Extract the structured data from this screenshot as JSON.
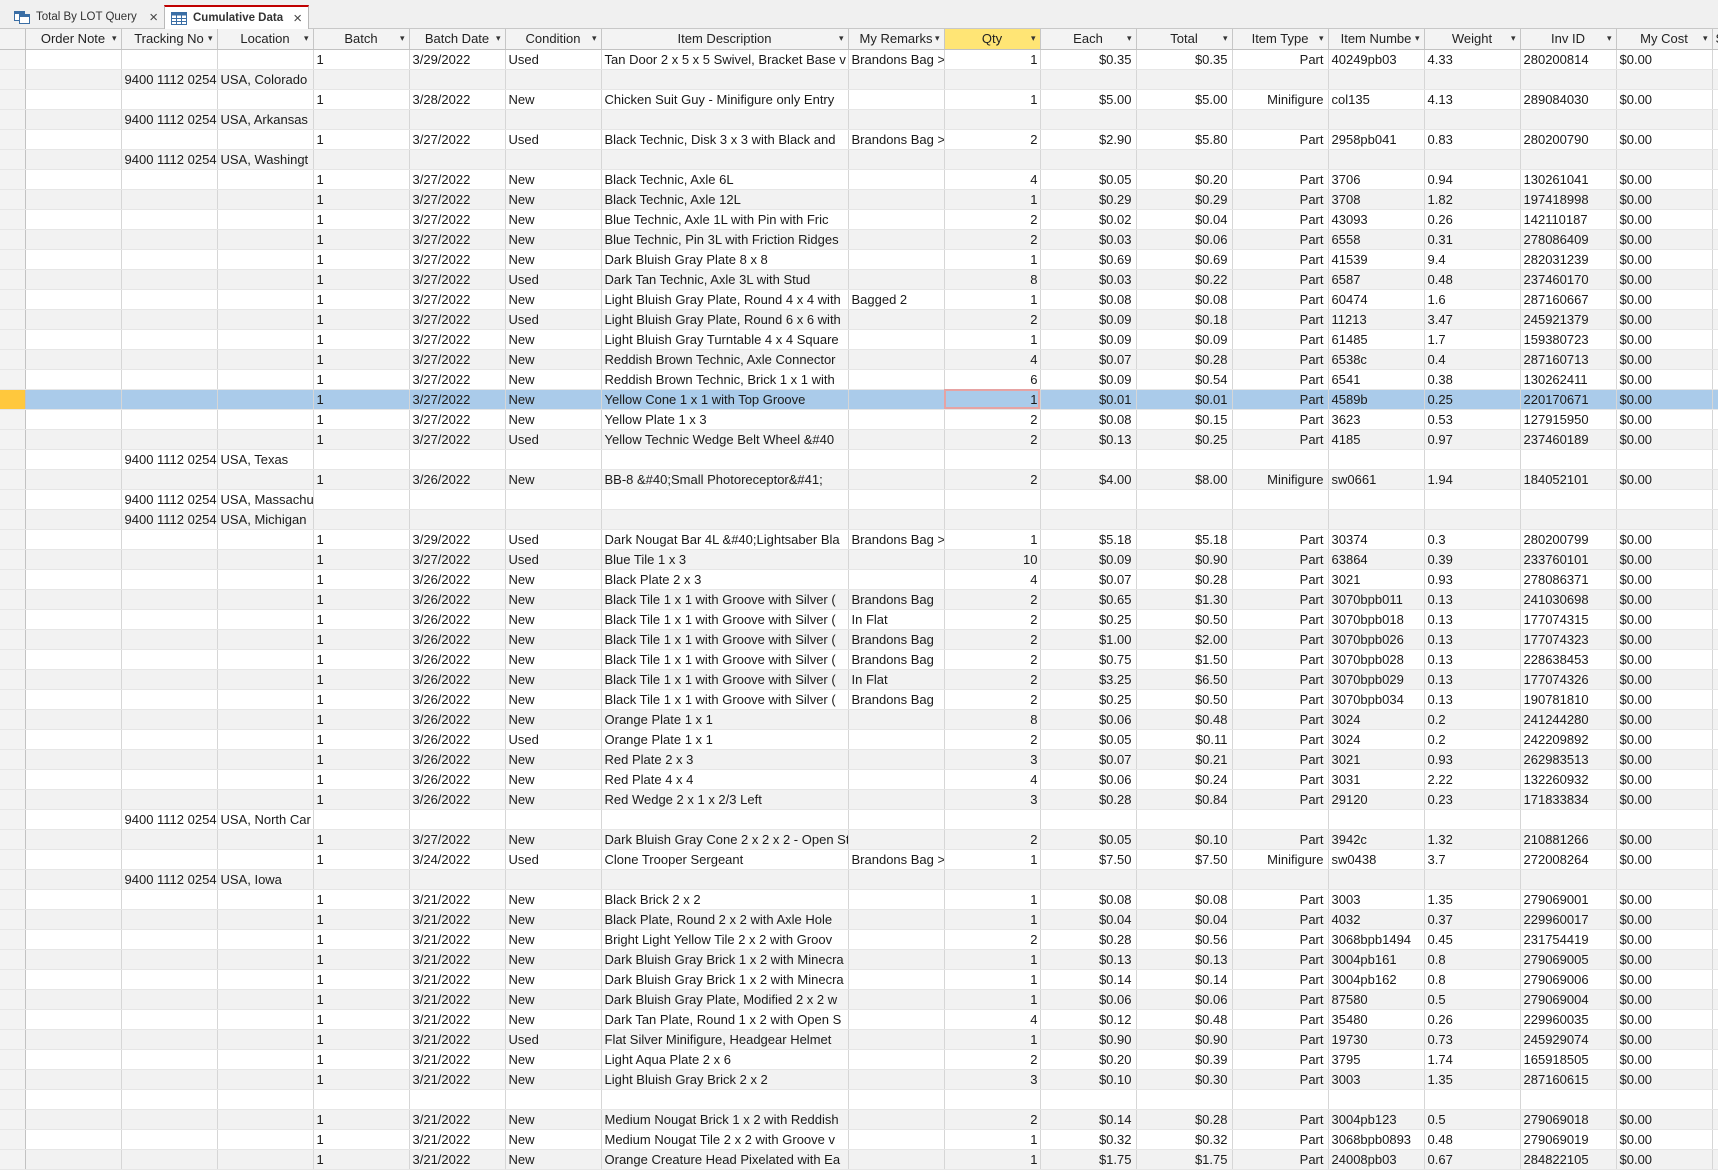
{
  "tabs": [
    {
      "label": "Total By LOT Query",
      "icon": "query-icon"
    },
    {
      "label": "Cumulative Data",
      "icon": "table-icon"
    }
  ],
  "columns": [
    "",
    "Order Note",
    "Tracking No",
    "Location",
    "Batch",
    "Batch Date",
    "Condition",
    "Item Description",
    "My Remarks",
    "Qty",
    "Each",
    "Total",
    "Item Type",
    "Item Numbe",
    "Weight",
    "Inv ID",
    "My Cost",
    "S"
  ],
  "selected_row": 17,
  "rows": [
    [
      "",
      "",
      "",
      "1",
      "3/29/2022",
      "Used",
      "Tan Door 2 x 5 x 5 Swivel, Bracket Base v",
      "Brandons Bag >",
      "1",
      "$0.35",
      "$0.35",
      "Part",
      "40249pb03",
      "4.33",
      "280200814",
      "$0.00",
      ""
    ],
    [
      "",
      "9400 1112 0254",
      "USA, Colorado",
      "",
      "",
      "",
      "",
      "",
      "",
      "",
      "",
      "",
      "",
      "",
      "",
      "",
      ""
    ],
    [
      "",
      "",
      "",
      "1",
      "3/28/2022",
      "New",
      "Chicken Suit Guy - Minifigure only Entry",
      "",
      "1",
      "$5.00",
      "$5.00",
      "Minifigure",
      "col135",
      "4.13",
      "289084030",
      "$0.00",
      ""
    ],
    [
      "",
      "9400 1112 0254",
      "USA, Arkansas",
      "",
      "",
      "",
      "",
      "",
      "",
      "",
      "",
      "",
      "",
      "",
      "",
      "",
      ""
    ],
    [
      "",
      "",
      "",
      "1",
      "3/27/2022",
      "Used",
      "Black Technic, Disk 3 x 3 with Black and ",
      "Brandons Bag >",
      "2",
      "$2.90",
      "$5.80",
      "Part",
      "2958pb041",
      "0.83",
      "280200790",
      "$0.00",
      ""
    ],
    [
      "",
      "9400 1112 0254",
      "USA, Washingt",
      "",
      "",
      "",
      "",
      "",
      "",
      "",
      "",
      "",
      "",
      "",
      "",
      "",
      ""
    ],
    [
      "",
      "",
      "",
      "1",
      "3/27/2022",
      "New",
      "Black Technic, Axle  6L",
      "",
      "4",
      "$0.05",
      "$0.20",
      "Part",
      "3706",
      "0.94",
      "130261041",
      "$0.00",
      ""
    ],
    [
      "",
      "",
      "",
      "1",
      "3/27/2022",
      "New",
      "Black Technic, Axle 12L",
      "",
      "1",
      "$0.29",
      "$0.29",
      "Part",
      "3708",
      "1.82",
      "197418998",
      "$0.00",
      ""
    ],
    [
      "",
      "",
      "",
      "1",
      "3/27/2022",
      "New",
      "Blue Technic, Axle  1L with Pin with Fric",
      "",
      "2",
      "$0.02",
      "$0.04",
      "Part",
      "43093",
      "0.26",
      "142110187",
      "$0.00",
      ""
    ],
    [
      "",
      "",
      "",
      "1",
      "3/27/2022",
      "New",
      "Blue Technic, Pin 3L with Friction Ridges",
      "",
      "2",
      "$0.03",
      "$0.06",
      "Part",
      "6558",
      "0.31",
      "278086409",
      "$0.00",
      ""
    ],
    [
      "",
      "",
      "",
      "1",
      "3/27/2022",
      "New",
      "Dark Bluish Gray Plate 8 x 8",
      "",
      "1",
      "$0.69",
      "$0.69",
      "Part",
      "41539",
      "9.4",
      "282031239",
      "$0.00",
      ""
    ],
    [
      "",
      "",
      "",
      "1",
      "3/27/2022",
      "Used",
      "Dark Tan Technic, Axle  3L with Stud",
      "",
      "8",
      "$0.03",
      "$0.22",
      "Part",
      "6587",
      "0.48",
      "237460170",
      "$0.00",
      ""
    ],
    [
      "",
      "",
      "",
      "1",
      "3/27/2022",
      "New",
      "Light Bluish Gray Plate, Round 4 x 4 with",
      "Bagged 2",
      "1",
      "$0.08",
      "$0.08",
      "Part",
      "60474",
      "1.6",
      "287160667",
      "$0.00",
      ""
    ],
    [
      "",
      "",
      "",
      "1",
      "3/27/2022",
      "Used",
      "Light Bluish Gray Plate, Round 6 x 6 with",
      "",
      "2",
      "$0.09",
      "$0.18",
      "Part",
      "11213",
      "3.47",
      "245921379",
      "$0.00",
      ""
    ],
    [
      "",
      "",
      "",
      "1",
      "3/27/2022",
      "New",
      "Light Bluish Gray Turntable 4 x 4 Square",
      "",
      "1",
      "$0.09",
      "$0.09",
      "Part",
      "61485",
      "1.7",
      "159380723",
      "$0.00",
      ""
    ],
    [
      "",
      "",
      "",
      "1",
      "3/27/2022",
      "New",
      "Reddish Brown Technic, Axle Connector",
      "",
      "4",
      "$0.07",
      "$0.28",
      "Part",
      "6538c",
      "0.4",
      "287160713",
      "$0.00",
      ""
    ],
    [
      "",
      "",
      "",
      "1",
      "3/27/2022",
      "New",
      "Reddish Brown Technic, Brick 1 x 1 with",
      "",
      "6",
      "$0.09",
      "$0.54",
      "Part",
      "6541",
      "0.38",
      "130262411",
      "$0.00",
      ""
    ],
    [
      "",
      "",
      "",
      "1",
      "3/27/2022",
      "New",
      "Yellow Cone 1 x 1 with Top Groove",
      "",
      "1",
      "$0.01",
      "$0.01",
      "Part",
      "4589b",
      "0.25",
      "220170671",
      "$0.00",
      ""
    ],
    [
      "",
      "",
      "",
      "1",
      "3/27/2022",
      "New",
      "Yellow Plate 1 x 3",
      "",
      "2",
      "$0.08",
      "$0.15",
      "Part",
      "3623",
      "0.53",
      "127915950",
      "$0.00",
      ""
    ],
    [
      "",
      "",
      "",
      "1",
      "3/27/2022",
      "Used",
      "Yellow Technic Wedge Belt Wheel &#40",
      "",
      "2",
      "$0.13",
      "$0.25",
      "Part",
      "4185",
      "0.97",
      "237460189",
      "$0.00",
      ""
    ],
    [
      "",
      "9400 1112 0254",
      "USA, Texas",
      "",
      "",
      "",
      "",
      "",
      "",
      "",
      "",
      "",
      "",
      "",
      "",
      "",
      ""
    ],
    [
      "",
      "",
      "",
      "1",
      "3/26/2022",
      "New",
      "BB-8 &#40;Small Photoreceptor&#41;",
      "",
      "2",
      "$4.00",
      "$8.00",
      "Minifigure",
      "sw0661",
      "1.94",
      "184052101",
      "$0.00",
      ""
    ],
    [
      "",
      "9400 1112 0254",
      "USA, Massachu",
      "",
      "",
      "",
      "",
      "",
      "",
      "",
      "",
      "",
      "",
      "",
      "",
      "",
      ""
    ],
    [
      "",
      "9400 1112 0254",
      "USA, Michigan",
      "",
      "",
      "",
      "",
      "",
      "",
      "",
      "",
      "",
      "",
      "",
      "",
      "",
      ""
    ],
    [
      "",
      "",
      "",
      "1",
      "3/29/2022",
      "Used",
      "Dark Nougat Bar  4L &#40;Lightsaber Bla",
      "Brandons Bag >",
      "1",
      "$5.18",
      "$5.18",
      "Part",
      "30374",
      "0.3",
      "280200799",
      "$0.00",
      ""
    ],
    [
      "",
      "",
      "",
      "1",
      "3/27/2022",
      "Used",
      "Blue Tile 1 x 3",
      "",
      "10",
      "$0.09",
      "$0.90",
      "Part",
      "63864",
      "0.39",
      "233760101",
      "$0.00",
      ""
    ],
    [
      "",
      "",
      "",
      "1",
      "3/26/2022",
      "New",
      "Black Plate 2 x 3",
      "",
      "4",
      "$0.07",
      "$0.28",
      "Part",
      "3021",
      "0.93",
      "278086371",
      "$0.00",
      ""
    ],
    [
      "",
      "",
      "",
      "1",
      "3/26/2022",
      "New",
      "Black Tile 1 x 1 with Groove with Silver (",
      "Brandons Bag",
      "2",
      "$0.65",
      "$1.30",
      "Part",
      "3070bpb011",
      "0.13",
      "241030698",
      "$0.00",
      ""
    ],
    [
      "",
      "",
      "",
      "1",
      "3/26/2022",
      "New",
      "Black Tile 1 x 1 with Groove with Silver (",
      "In Flat",
      "2",
      "$0.25",
      "$0.50",
      "Part",
      "3070bpb018",
      "0.13",
      "177074315",
      "$0.00",
      ""
    ],
    [
      "",
      "",
      "",
      "1",
      "3/26/2022",
      "New",
      "Black Tile 1 x 1 with Groove with Silver (",
      "Brandons Bag",
      "2",
      "$1.00",
      "$2.00",
      "Part",
      "3070bpb026",
      "0.13",
      "177074323",
      "$0.00",
      ""
    ],
    [
      "",
      "",
      "",
      "1",
      "3/26/2022",
      "New",
      "Black Tile 1 x 1 with Groove with Silver (",
      "Brandons Bag",
      "2",
      "$0.75",
      "$1.50",
      "Part",
      "3070bpb028",
      "0.13",
      "228638453",
      "$0.00",
      ""
    ],
    [
      "",
      "",
      "",
      "1",
      "3/26/2022",
      "New",
      "Black Tile 1 x 1 with Groove with Silver (",
      "In Flat",
      "2",
      "$3.25",
      "$6.50",
      "Part",
      "3070bpb029",
      "0.13",
      "177074326",
      "$0.00",
      ""
    ],
    [
      "",
      "",
      "",
      "1",
      "3/26/2022",
      "New",
      "Black Tile 1 x 1 with Groove with Silver (",
      "Brandons Bag",
      "2",
      "$0.25",
      "$0.50",
      "Part",
      "3070bpb034",
      "0.13",
      "190781810",
      "$0.00",
      ""
    ],
    [
      "",
      "",
      "",
      "1",
      "3/26/2022",
      "New",
      "Orange Plate 1 x 1",
      "",
      "8",
      "$0.06",
      "$0.48",
      "Part",
      "3024",
      "0.2",
      "241244280",
      "$0.00",
      ""
    ],
    [
      "",
      "",
      "",
      "1",
      "3/26/2022",
      "Used",
      "Orange Plate 1 x 1",
      "",
      "2",
      "$0.05",
      "$0.11",
      "Part",
      "3024",
      "0.2",
      "242209892",
      "$0.00",
      ""
    ],
    [
      "",
      "",
      "",
      "1",
      "3/26/2022",
      "New",
      "Red Plate 2 x 3",
      "",
      "3",
      "$0.07",
      "$0.21",
      "Part",
      "3021",
      "0.93",
      "262983513",
      "$0.00",
      ""
    ],
    [
      "",
      "",
      "",
      "1",
      "3/26/2022",
      "New",
      "Red Plate 4 x 4",
      "",
      "4",
      "$0.06",
      "$0.24",
      "Part",
      "3031",
      "2.22",
      "132260932",
      "$0.00",
      ""
    ],
    [
      "",
      "",
      "",
      "1",
      "3/26/2022",
      "New",
      "Red Wedge 2 x 1 x 2/3 Left",
      "",
      "3",
      "$0.28",
      "$0.84",
      "Part",
      "29120",
      "0.23",
      "171833834",
      "$0.00",
      ""
    ],
    [
      "",
      "9400 1112 0254",
      "USA, North Car",
      "",
      "",
      "",
      "",
      "",
      "",
      "",
      "",
      "",
      "",
      "",
      "",
      "",
      ""
    ],
    [
      "",
      "",
      "",
      "1",
      "3/27/2022",
      "New",
      "Dark Bluish Gray Cone 2 x 2 x 2 - Open St",
      "",
      "2",
      "$0.05",
      "$0.10",
      "Part",
      "3942c",
      "1.32",
      "210881266",
      "$0.00",
      ""
    ],
    [
      "",
      "",
      "",
      "1",
      "3/24/2022",
      "Used",
      "Clone Trooper Sergeant",
      "Brandons Bag >",
      "1",
      "$7.50",
      "$7.50",
      "Minifigure",
      "sw0438",
      "3.7",
      "272008264",
      "$0.00",
      ""
    ],
    [
      "",
      "9400 1112 0254",
      "USA, Iowa",
      "",
      "",
      "",
      "",
      "",
      "",
      "",
      "",
      "",
      "",
      "",
      "",
      "",
      ""
    ],
    [
      "",
      "",
      "",
      "1",
      "3/21/2022",
      "New",
      "Black Brick 2 x 2",
      "",
      "1",
      "$0.08",
      "$0.08",
      "Part",
      "3003",
      "1.35",
      "279069001",
      "$0.00",
      ""
    ],
    [
      "",
      "",
      "",
      "1",
      "3/21/2022",
      "New",
      "Black Plate, Round 2 x 2 with Axle Hole",
      "",
      "1",
      "$0.04",
      "$0.04",
      "Part",
      "4032",
      "0.37",
      "229960017",
      "$0.00",
      ""
    ],
    [
      "",
      "",
      "",
      "1",
      "3/21/2022",
      "New",
      "Bright Light Yellow Tile 2 x 2 with Groov",
      "",
      "2",
      "$0.28",
      "$0.56",
      "Part",
      "3068bpb1494",
      "0.45",
      "231754419",
      "$0.00",
      ""
    ],
    [
      "",
      "",
      "",
      "1",
      "3/21/2022",
      "New",
      "Dark Bluish Gray Brick 1 x 2 with Minecra",
      "",
      "1",
      "$0.13",
      "$0.13",
      "Part",
      "3004pb161",
      "0.8",
      "279069005",
      "$0.00",
      ""
    ],
    [
      "",
      "",
      "",
      "1",
      "3/21/2022",
      "New",
      "Dark Bluish Gray Brick 1 x 2 with Minecra",
      "",
      "1",
      "$0.14",
      "$0.14",
      "Part",
      "3004pb162",
      "0.8",
      "279069006",
      "$0.00",
      ""
    ],
    [
      "",
      "",
      "",
      "1",
      "3/21/2022",
      "New",
      "Dark Bluish Gray Plate, Modified 2 x 2 w",
      "",
      "1",
      "$0.06",
      "$0.06",
      "Part",
      "87580",
      "0.5",
      "279069004",
      "$0.00",
      ""
    ],
    [
      "",
      "",
      "",
      "1",
      "3/21/2022",
      "New",
      "Dark Tan Plate, Round 1 x 2 with Open S",
      "",
      "4",
      "$0.12",
      "$0.48",
      "Part",
      "35480",
      "0.26",
      "229960035",
      "$0.00",
      ""
    ],
    [
      "",
      "",
      "",
      "1",
      "3/21/2022",
      "Used",
      "Flat Silver Minifigure, Headgear Helmet",
      "",
      "1",
      "$0.90",
      "$0.90",
      "Part",
      "19730",
      "0.73",
      "245929074",
      "$0.00",
      ""
    ],
    [
      "",
      "",
      "",
      "1",
      "3/21/2022",
      "New",
      "Light Aqua Plate 2 x 6",
      "",
      "2",
      "$0.20",
      "$0.39",
      "Part",
      "3795",
      "1.74",
      "165918505",
      "$0.00",
      ""
    ],
    [
      "",
      "",
      "",
      "1",
      "3/21/2022",
      "New",
      "Light Bluish Gray Brick 2 x 2",
      "",
      "3",
      "$0.10",
      "$0.30",
      "Part",
      "3003",
      "1.35",
      "287160615",
      "$0.00",
      ""
    ],
    [
      "",
      "",
      "",
      "",
      "",
      "",
      "",
      "",
      "",
      "",
      "",
      "",
      "",
      "",
      "",
      "",
      ""
    ],
    [
      "",
      "",
      "",
      "1",
      "3/21/2022",
      "New",
      "Medium Nougat Brick 1 x 2 with Reddish",
      "",
      "2",
      "$0.14",
      "$0.28",
      "Part",
      "3004pb123",
      "0.5",
      "279069018",
      "$0.00",
      ""
    ],
    [
      "",
      "",
      "",
      "1",
      "3/21/2022",
      "New",
      "Medium Nougat Tile 2 x 2 with Groove v",
      "",
      "1",
      "$0.32",
      "$0.32",
      "Part",
      "3068bpb0893",
      "0.48",
      "279069019",
      "$0.00",
      ""
    ],
    [
      "",
      "",
      "",
      "1",
      "3/21/2022",
      "New",
      "Orange Creature Head Pixelated with Ea",
      "",
      "1",
      "$1.75",
      "$1.75",
      "Part",
      "24008pb03",
      "0.67",
      "284822105",
      "$0.00",
      ""
    ]
  ]
}
